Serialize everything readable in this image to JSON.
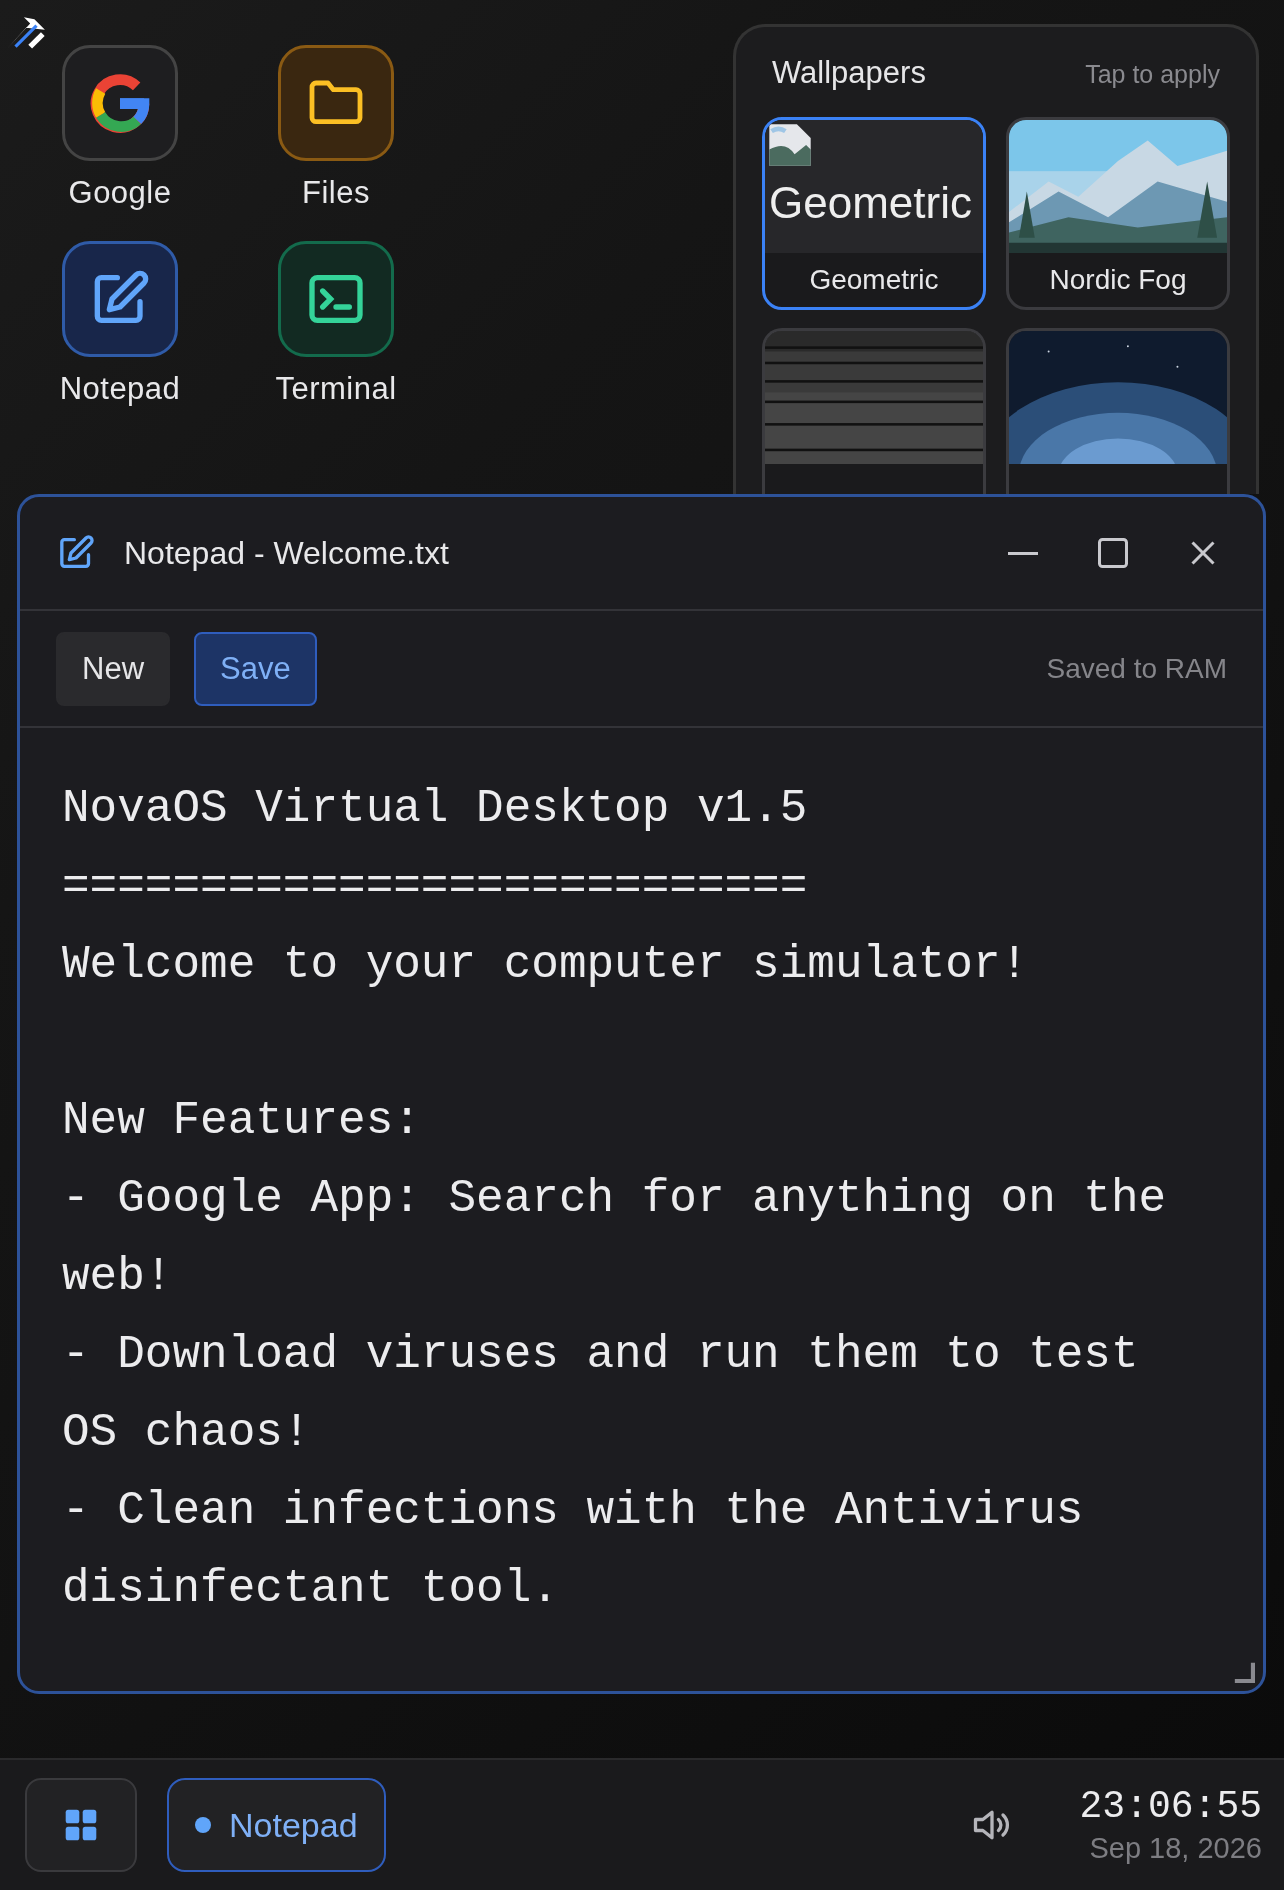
{
  "desktop_icons": [
    {
      "label": "Google",
      "kind": "google"
    },
    {
      "label": "Files",
      "kind": "folder"
    },
    {
      "label": "Notepad",
      "kind": "notepad"
    },
    {
      "label": "Terminal",
      "kind": "terminal"
    }
  ],
  "wallpapers_panel": {
    "title": "Wallpapers",
    "hint": "Tap to apply",
    "items": [
      {
        "label": "Geometric",
        "alt": "Geometric",
        "selected": true
      },
      {
        "label": "Nordic Fog",
        "selected": false
      },
      {
        "selected": false
      },
      {
        "selected": false
      }
    ]
  },
  "window": {
    "title": "Notepad - Welcome.txt",
    "toolbar": [
      {
        "label": "New",
        "selected": false
      },
      {
        "label": "Save",
        "selected": true
      }
    ],
    "status": "Saved to RAM",
    "content": "NovaOS Virtual Desktop v1.5\n===========================\nWelcome to your computer simulator!\n\nNew Features:\n- Google App: Search for anything on the web!\n- Download viruses and run them to test OS chaos!\n- Clean infections with the Antivirus disinfectant tool."
  },
  "taskbar": {
    "tasks": [
      {
        "label": "Notepad",
        "selected": true
      }
    ],
    "time": "23:06:55",
    "date": "Sep 18, 2026"
  }
}
